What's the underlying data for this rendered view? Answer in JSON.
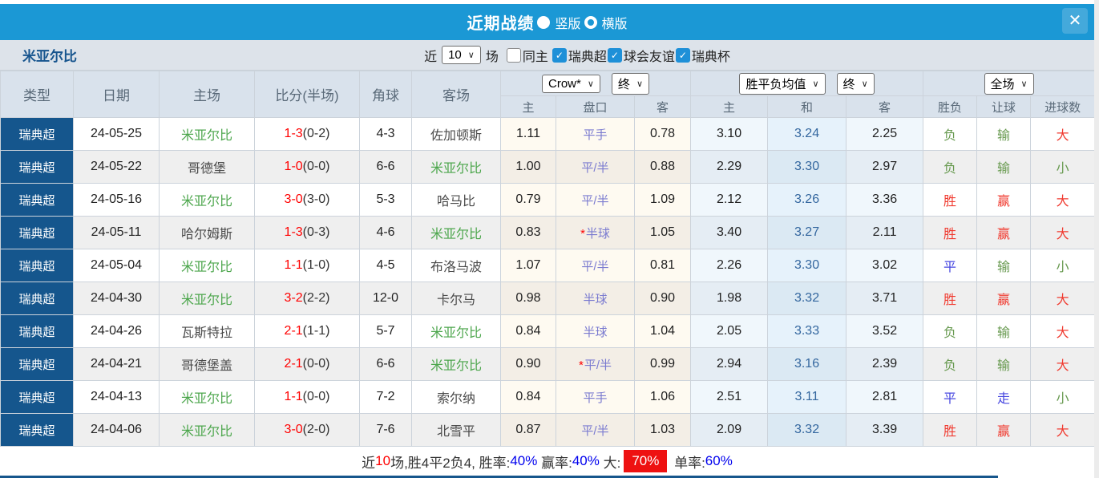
{
  "icons": {
    "chevron_glyph": "∨",
    "check_glyph": "✓",
    "close_glyph": "✕"
  },
  "colors": {
    "titlebar_blue": "#1b98d5",
    "league_badge_blue": "#15568d",
    "win_red": "#f03b30",
    "lose_green": "#689a50",
    "draw_blue": "#4747e0",
    "self_team_green": "#4ca64c",
    "avg_draw_blue": "#34679f",
    "handicap_purple": "#7b7bd0",
    "summary_badge_red": "#ee1111",
    "summary_value_blue": "#0000ee"
  },
  "titlebar": {
    "title": "近期战绩",
    "layout_options": [
      {
        "label": "竖版",
        "selected": true
      },
      {
        "label": "横版",
        "selected": false
      }
    ]
  },
  "filterbar": {
    "team_name": "米亚尔比",
    "recent_label": "近",
    "recent_count": "10",
    "matches_label": "场",
    "checkboxes": [
      {
        "label": "同主",
        "checked": false
      },
      {
        "label": "瑞典超",
        "checked": true
      },
      {
        "label": "球会友谊",
        "checked": true
      },
      {
        "label": "瑞典杯",
        "checked": true
      }
    ]
  },
  "table": {
    "left_headers": [
      "类型",
      "日期",
      "主场",
      "比分(半场)",
      "角球",
      "客场"
    ],
    "group_controls": {
      "bookmaker": "Crow*",
      "bookmaker_period": "终",
      "avg": "胜平负均值",
      "avg_period": "终",
      "scope": "全场"
    },
    "sub_headers": [
      "主",
      "盘口",
      "客",
      "主",
      "和",
      "客",
      "胜负",
      "让球",
      "进球数"
    ],
    "rows": [
      {
        "league": "瑞典超",
        "date": "24-05-25",
        "home": "米亚尔比",
        "home_is_self": true,
        "score": "1-3",
        "half": "(0-2)",
        "corners": "4-3",
        "away": "佐加顿斯",
        "away_is_self": false,
        "odds_home": "1.11",
        "line": "平手",
        "line_starred": false,
        "odds_away": "0.78",
        "avg_home": "3.10",
        "avg_draw": "3.24",
        "avg_away": "2.25",
        "result": "负",
        "result_style": "green",
        "handicap_result": "输",
        "handicap_result_style": "green",
        "goals_result": "大",
        "goals_result_style": "red"
      },
      {
        "league": "瑞典超",
        "date": "24-05-22",
        "home": "哥德堡",
        "home_is_self": false,
        "score": "1-0",
        "half": "(0-0)",
        "corners": "6-6",
        "away": "米亚尔比",
        "away_is_self": true,
        "odds_home": "1.00",
        "line": "平/半",
        "line_starred": false,
        "odds_away": "0.88",
        "avg_home": "2.29",
        "avg_draw": "3.30",
        "avg_away": "2.97",
        "result": "负",
        "result_style": "green",
        "handicap_result": "输",
        "handicap_result_style": "green",
        "goals_result": "小",
        "goals_result_style": "green"
      },
      {
        "league": "瑞典超",
        "date": "24-05-16",
        "home": "米亚尔比",
        "home_is_self": true,
        "score": "3-0",
        "half": "(3-0)",
        "corners": "5-3",
        "away": "哈马比",
        "away_is_self": false,
        "odds_home": "0.79",
        "line": "平/半",
        "line_starred": false,
        "odds_away": "1.09",
        "avg_home": "2.12",
        "avg_draw": "3.26",
        "avg_away": "3.36",
        "result": "胜",
        "result_style": "red",
        "handicap_result": "赢",
        "handicap_result_style": "red",
        "goals_result": "大",
        "goals_result_style": "red"
      },
      {
        "league": "瑞典超",
        "date": "24-05-11",
        "home": "哈尔姆斯",
        "home_is_self": false,
        "score": "1-3",
        "half": "(0-3)",
        "corners": "4-6",
        "away": "米亚尔比",
        "away_is_self": true,
        "odds_home": "0.83",
        "line": "半球",
        "line_starred": true,
        "odds_away": "1.05",
        "avg_home": "3.40",
        "avg_draw": "3.27",
        "avg_away": "2.11",
        "result": "胜",
        "result_style": "red",
        "handicap_result": "赢",
        "handicap_result_style": "red",
        "goals_result": "大",
        "goals_result_style": "red"
      },
      {
        "league": "瑞典超",
        "date": "24-05-04",
        "home": "米亚尔比",
        "home_is_self": true,
        "score": "1-1",
        "half": "(1-0)",
        "corners": "4-5",
        "away": "布洛马波",
        "away_is_self": false,
        "odds_home": "1.07",
        "line": "平/半",
        "line_starred": false,
        "odds_away": "0.81",
        "avg_home": "2.26",
        "avg_draw": "3.30",
        "avg_away": "3.02",
        "result": "平",
        "result_style": "draw",
        "handicap_result": "输",
        "handicap_result_style": "green",
        "goals_result": "小",
        "goals_result_style": "green"
      },
      {
        "league": "瑞典超",
        "date": "24-04-30",
        "home": "米亚尔比",
        "home_is_self": true,
        "score": "3-2",
        "half": "(2-2)",
        "corners": "12-0",
        "away": "卡尔马",
        "away_is_self": false,
        "odds_home": "0.98",
        "line": "半球",
        "line_starred": false,
        "odds_away": "0.90",
        "avg_home": "1.98",
        "avg_draw": "3.32",
        "avg_away": "3.71",
        "result": "胜",
        "result_style": "red",
        "handicap_result": "赢",
        "handicap_result_style": "red",
        "goals_result": "大",
        "goals_result_style": "red"
      },
      {
        "league": "瑞典超",
        "date": "24-04-26",
        "home": "瓦斯特拉",
        "home_is_self": false,
        "score": "2-1",
        "half": "(1-1)",
        "corners": "5-7",
        "away": "米亚尔比",
        "away_is_self": true,
        "odds_home": "0.84",
        "line": "半球",
        "line_starred": false,
        "odds_away": "1.04",
        "avg_home": "2.05",
        "avg_draw": "3.33",
        "avg_away": "3.52",
        "result": "负",
        "result_style": "green",
        "handicap_result": "输",
        "handicap_result_style": "green",
        "goals_result": "大",
        "goals_result_style": "red"
      },
      {
        "league": "瑞典超",
        "date": "24-04-21",
        "home": "哥德堡盖",
        "home_is_self": false,
        "score": "2-1",
        "half": "(0-0)",
        "corners": "6-6",
        "away": "米亚尔比",
        "away_is_self": true,
        "odds_home": "0.90",
        "line": "平/半",
        "line_starred": true,
        "odds_away": "0.99",
        "avg_home": "2.94",
        "avg_draw": "3.16",
        "avg_away": "2.39",
        "result": "负",
        "result_style": "green",
        "handicap_result": "输",
        "handicap_result_style": "green",
        "goals_result": "大",
        "goals_result_style": "red"
      },
      {
        "league": "瑞典超",
        "date": "24-04-13",
        "home": "米亚尔比",
        "home_is_self": true,
        "score": "1-1",
        "half": "(0-0)",
        "corners": "7-2",
        "away": "索尔纳",
        "away_is_self": false,
        "odds_home": "0.84",
        "line": "平手",
        "line_starred": false,
        "odds_away": "1.06",
        "avg_home": "2.51",
        "avg_draw": "3.11",
        "avg_away": "2.81",
        "result": "平",
        "result_style": "draw",
        "handicap_result": "走",
        "handicap_result_style": "draw",
        "goals_result": "小",
        "goals_result_style": "green"
      },
      {
        "league": "瑞典超",
        "date": "24-04-06",
        "home": "米亚尔比",
        "home_is_self": true,
        "score": "3-0",
        "half": "(2-0)",
        "corners": "7-6",
        "away": "北雪平",
        "away_is_self": false,
        "odds_home": "0.87",
        "line": "平/半",
        "line_starred": false,
        "odds_away": "1.03",
        "avg_home": "2.09",
        "avg_draw": "3.32",
        "avg_away": "3.39",
        "result": "胜",
        "result_style": "red",
        "handicap_result": "赢",
        "handicap_result_style": "red",
        "goals_result": "大",
        "goals_result_style": "red"
      }
    ]
  },
  "summary": {
    "segments": [
      {
        "text": "近",
        "style": "plain"
      },
      {
        "text": "10",
        "style": "red"
      },
      {
        "text": "场,胜4平2负4, 胜率:",
        "style": "plain"
      },
      {
        "text": "40%",
        "style": "blue"
      },
      {
        "text": " 赢率:",
        "style": "plain"
      },
      {
        "text": "40%",
        "style": "blue"
      },
      {
        "text": " 大:",
        "style": "plain"
      },
      {
        "text": "70%",
        "style": "red-badge"
      },
      {
        "text": " 单率:",
        "style": "plain"
      },
      {
        "text": "60%",
        "style": "blue"
      }
    ]
  }
}
